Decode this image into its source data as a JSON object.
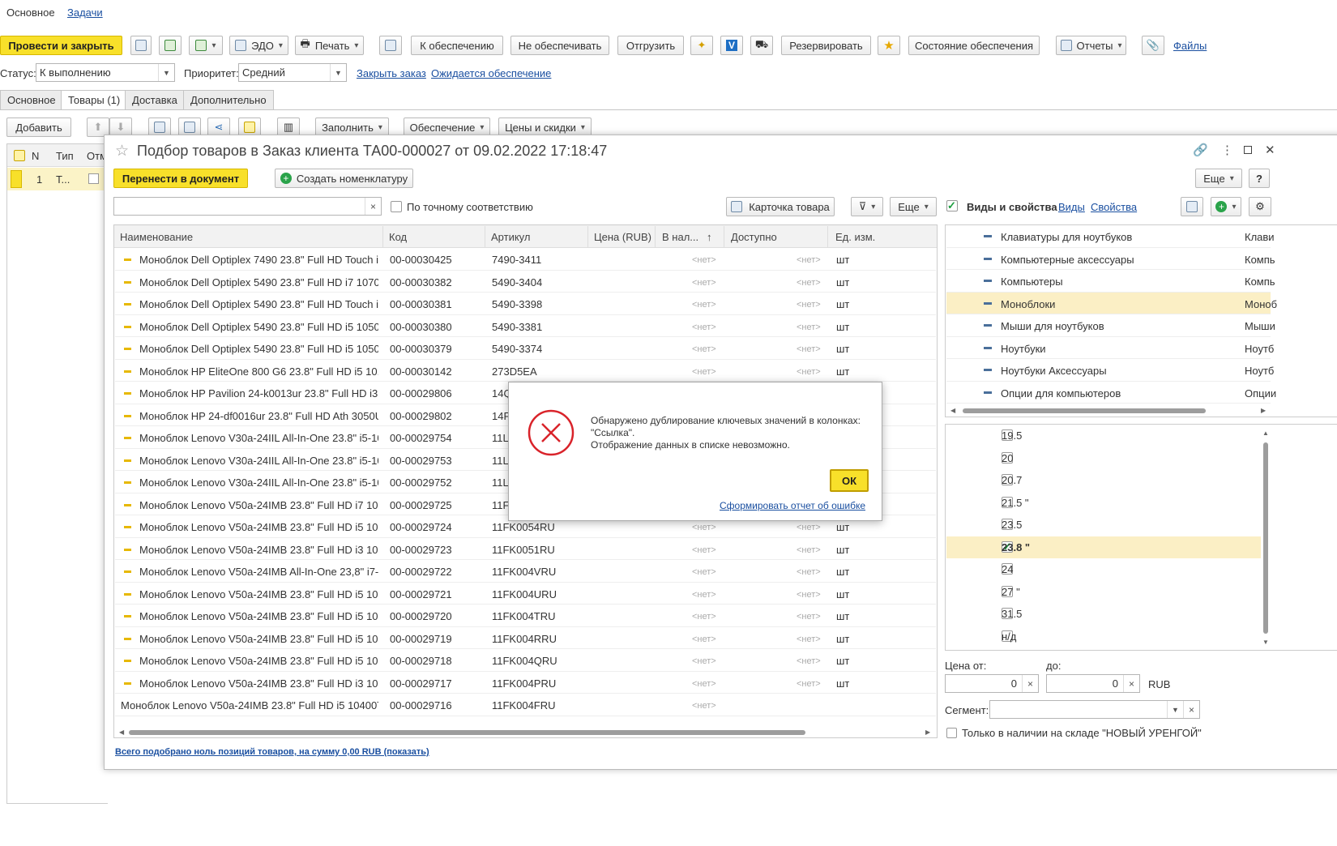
{
  "top_tabs": [
    "Основное",
    "Задачи"
  ],
  "toolbar": {
    "post_close": "Провести и закрыть",
    "edo": "ЭДО",
    "print": "Печать",
    "to_supply": "К обеспечению",
    "no_supply": "Не обеспечивать",
    "ship": "Отгрузить",
    "reserve": "Резервировать",
    "supply_state": "Состояние обеспечения",
    "reports": "Отчеты",
    "files": "Файлы"
  },
  "status": {
    "label": "Статус:",
    "value": "К выполнению",
    "priority_label": "Приоритет:",
    "priority_value": "Средний",
    "close_order": "Закрыть заказ",
    "awaiting": "Ожидается обеспечение"
  },
  "doc_tabs": [
    "Основное",
    "Товары (1)",
    "Доставка",
    "Дополнительно"
  ],
  "goods_toolbar": {
    "add": "Добавить",
    "fill": "Заполнить",
    "supply": "Обеспечение",
    "prices": "Цены и скидки"
  },
  "goods_table": {
    "headers": [
      "N",
      "Тип",
      "Отм"
    ],
    "row": {
      "n": "1",
      "type": "Т..."
    }
  },
  "picker": {
    "title": "Подбор товаров в Заказ клиента ТА00-000027 от 09.02.2022 17:18:47",
    "transfer": "Перенести в документ",
    "create_item": "Создать номенклатуру",
    "more": "Еще",
    "help": "?",
    "search_placeholder": "",
    "exact": "По точному соответствию",
    "card": "Карточка товара",
    "more2": "Еще",
    "kinds_label": "Виды и свойства",
    "kinds_link": "Виды",
    "props_link": "Свойства",
    "columns": [
      "Наименование",
      "Код",
      "Артикул",
      "Цена (RUB)",
      "В нал...",
      "Доступно",
      "Ед. изм."
    ],
    "rows": [
      {
        "name": "Моноблок Dell Optiplex 7490 23.8\" Full HD Touch i...",
        "code": "00-00030425",
        "art": "7490-3411",
        "stock": "<нет>",
        "avail": "<нет>",
        "unit": "шт"
      },
      {
        "name": "Моноблок Dell Optiplex 5490 23.8\" Full HD i7 1070...",
        "code": "00-00030382",
        "art": "5490-3404",
        "stock": "<нет>",
        "avail": "<нет>",
        "unit": "шт"
      },
      {
        "name": "Моноблок Dell Optiplex 5490 23.8\" Full HD Touch i...",
        "code": "00-00030381",
        "art": "5490-3398",
        "stock": "<нет>",
        "avail": "<нет>",
        "unit": "шт"
      },
      {
        "name": "Моноблок Dell Optiplex 5490 23.8\" Full HD i5 1050...",
        "code": "00-00030380",
        "art": "5490-3381",
        "stock": "<нет>",
        "avail": "<нет>",
        "unit": "шт"
      },
      {
        "name": "Моноблок Dell Optiplex 5490 23.8\" Full HD i5 1050...",
        "code": "00-00030379",
        "art": "5490-3374",
        "stock": "<нет>",
        "avail": "<нет>",
        "unit": "шт"
      },
      {
        "name": "Моноблок HP EliteOne 800 G6 23.8\" Full HD i5 10...",
        "code": "00-00030142",
        "art": "273D5EA",
        "stock": "<нет>",
        "avail": "<нет>",
        "unit": "шт"
      },
      {
        "name": "Моноблок HP Pavilion 24-k0013ur 23.8\" Full HD i3 ...",
        "code": "00-00029806",
        "art": "14Q",
        "stock": "",
        "avail": "",
        "unit": ""
      },
      {
        "name": "Моноблок HP 24-df0016ur 23.8\" Full HD Ath 3050U...",
        "code": "00-00029802",
        "art": "14F",
        "stock": "",
        "avail": "",
        "unit": ""
      },
      {
        "name": "Моноблок Lenovo V30a-24IIL All-In-One 23.8\" i5-10...",
        "code": "00-00029754",
        "art": "11L",
        "stock": "",
        "avail": "",
        "unit": ""
      },
      {
        "name": "Моноблок Lenovo V30a-24IIL All-In-One 23.8\" i5-10...",
        "code": "00-00029753",
        "art": "11L",
        "stock": "",
        "avail": "",
        "unit": ""
      },
      {
        "name": "Моноблок Lenovo V30a-24IIL All-In-One 23.8\" i5-10...",
        "code": "00-00029752",
        "art": "11L",
        "stock": "",
        "avail": "",
        "unit": ""
      },
      {
        "name": "Моноблок Lenovo V50a-24IMB 23.8\" Full HD i7 10...",
        "code": "00-00029725",
        "art": "11F",
        "stock": "",
        "avail": "",
        "unit": ""
      },
      {
        "name": "Моноблок Lenovo V50a-24IMB 23.8\" Full HD i5 10...",
        "code": "00-00029724",
        "art": "11FK0054RU",
        "stock": "<нет>",
        "avail": "<нет>",
        "unit": "шт"
      },
      {
        "name": "Моноблок Lenovo V50a-24IMB 23.8\" Full HD i3 10...",
        "code": "00-00029723",
        "art": "11FK0051RU",
        "stock": "<нет>",
        "avail": "<нет>",
        "unit": "шт"
      },
      {
        "name": "Моноблок Lenovo V50a-24IMB All-In-One 23,8\" i7-1...",
        "code": "00-00029722",
        "art": "11FK004VRU",
        "stock": "<нет>",
        "avail": "<нет>",
        "unit": "шт"
      },
      {
        "name": "Моноблок Lenovo V50a-24IMB 23.8\" Full HD i5 10...",
        "code": "00-00029721",
        "art": "11FK004URU",
        "stock": "<нет>",
        "avail": "<нет>",
        "unit": "шт"
      },
      {
        "name": "Моноблок Lenovo V50a-24IMB 23.8\" Full HD i5 10...",
        "code": "00-00029720",
        "art": "11FK004TRU",
        "stock": "<нет>",
        "avail": "<нет>",
        "unit": "шт"
      },
      {
        "name": "Моноблок Lenovo V50a-24IMB 23.8\" Full HD i5 10...",
        "code": "00-00029719",
        "art": "11FK004RRU",
        "stock": "<нет>",
        "avail": "<нет>",
        "unit": "шт"
      },
      {
        "name": "Моноблок Lenovo V50a-24IMB 23.8\" Full HD i5 10...",
        "code": "00-00029718",
        "art": "11FK004QRU",
        "stock": "<нет>",
        "avail": "<нет>",
        "unit": "шт"
      },
      {
        "name": "Моноблок Lenovo V50a-24IMB 23.8\" Full HD i3 10...",
        "code": "00-00029717",
        "art": "11FK004PRU",
        "stock": "<нет>",
        "avail": "<нет>",
        "unit": "шт"
      },
      {
        "name": "Моноблок Lenovo V50a-24IMB 23.8\" Full HD i5 10400T...",
        "code": "00-00029716",
        "art": "11FK004FRU",
        "stock": "<нет>",
        "avail": "",
        "unit": ""
      }
    ],
    "categories": [
      {
        "name": "Клавиатуры для ноутбуков",
        "short": "Клави"
      },
      {
        "name": "Компьютерные аксессуары",
        "short": "Компь"
      },
      {
        "name": "Компьютеры",
        "short": "Компь"
      },
      {
        "name": "Моноблоки",
        "short": "Моноб"
      },
      {
        "name": "Мыши для ноутбуков",
        "short": "Мыши"
      },
      {
        "name": "Ноутбуки",
        "short": "Ноутб"
      },
      {
        "name": "Ноутбуки Аксессуары",
        "short": "Ноутб"
      },
      {
        "name": "Опции для компьютеров",
        "short": "Опции"
      }
    ],
    "sizes": [
      "19.5",
      "20",
      "20.7",
      "21.5 \"",
      "23.5",
      "23.8 \"",
      "24",
      "27 \"",
      "31.5",
      "н/д"
    ],
    "price_from_label": "Цена от:",
    "price_to_label": "до:",
    "price_from": "0",
    "price_to": "0",
    "currency": "RUB",
    "segment_label": "Сегмент:",
    "only_stock": "Только в наличии на складе \"НОВЫЙ УРЕНГОЙ\"",
    "summary": "Всего подобрано ноль позиций товаров, на сумму 0,00 RUB (показать)"
  },
  "dialog": {
    "line1": "Обнаружено дублирование ключевых значений в колонках:",
    "line2": "\"Ссылка\".",
    "line3": "Отображение данных в списке невозможно.",
    "ok": "ОК",
    "report_link": "Сформировать отчет об ошибке"
  }
}
